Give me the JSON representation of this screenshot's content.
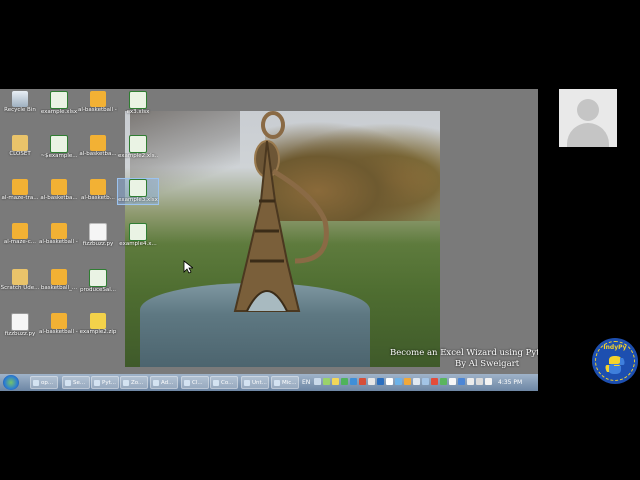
{
  "desktop": {
    "icons": [
      {
        "label": "Recycle Bin",
        "glyph": "recycle-bin-icon"
      },
      {
        "label": "example.xlsx",
        "glyph": "excel-file-icon"
      },
      {
        "label": "al-basketball - Copy (2).xlsx",
        "glyph": "scratch-file-icon"
      },
      {
        "label": "ex3.xlsx",
        "glyph": "excel-file-icon"
      },
      {
        "label": "CLOSET",
        "glyph": "folder-icon"
      },
      {
        "label": "~$example...",
        "glyph": "excel-file-icon"
      },
      {
        "label": "al-basketba...",
        "glyph": "scratch-file-icon"
      },
      {
        "label": "example2.xls...",
        "glyph": "excel-file-icon"
      },
      {
        "label": "al-maze-tra...",
        "glyph": "scratch-file-icon"
      },
      {
        "label": "al-basketba...",
        "glyph": "scratch-file-icon"
      },
      {
        "label": "al-basketb...",
        "glyph": "scratch-file-icon"
      },
      {
        "label": "example3.xlsx",
        "glyph": "excel-file-icon"
      },
      {
        "label": "al-maze-c...",
        "glyph": "scratch-file-icon"
      },
      {
        "label": "al-basketball - Copy.sb2",
        "glyph": "scratch-file-icon"
      },
      {
        "label": "fizzbuzz.py",
        "glyph": "text-file-icon"
      },
      {
        "label": "example4.x...",
        "glyph": "excel-file-icon"
      },
      {
        "label": "Scratch Ude...",
        "glyph": "folder-icon"
      },
      {
        "label": "basketball_...",
        "glyph": "scratch-file-icon"
      },
      {
        "label": "produceSal...",
        "glyph": "excel-file-icon"
      },
      {
        "label": "fizzbuzz.py",
        "glyph": "python-file-icon"
      },
      {
        "label": "al-basketball - Copy (2).s...",
        "glyph": "scratch-file-icon"
      },
      {
        "label": "example2.zip",
        "glyph": "zip-file-icon"
      }
    ]
  },
  "overlay": {
    "title_line": "Become an Excel Wizard using Python Scripting",
    "author_line": "By Al Sweigart"
  },
  "logo": {
    "text": "IndyPy"
  },
  "taskbar": {
    "start_label": "Start",
    "tasks": [
      "op...",
      "Se...",
      "Pyt...",
      "Zo...",
      "Ad...",
      "Cl...",
      "Co...",
      "Unt...",
      "Mic..."
    ],
    "language": "EN",
    "clock": "4:35 PM"
  },
  "colors": {
    "taskbar": "#7e95b2",
    "logo_bg": "#1d4fb0",
    "logo_accent": "#f5d32b"
  }
}
